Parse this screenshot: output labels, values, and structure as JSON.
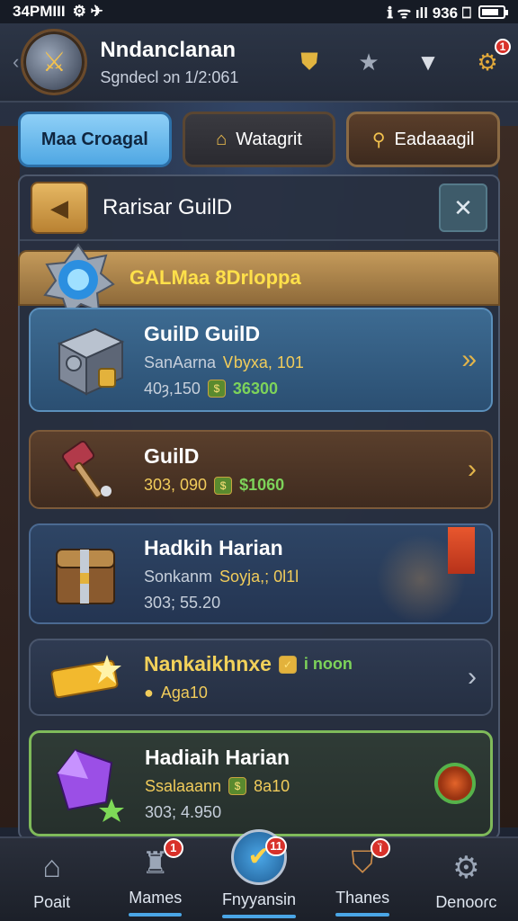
{
  "status": {
    "time": "34PMΙΙΙ",
    "left_icons": "⚙ ✈",
    "right": "ℹ ᯤ ıll 936 ⎕"
  },
  "header": {
    "title": "Nndanclanan",
    "subtitle": "Sgndecl ɔn 1/2:061"
  },
  "tabs": [
    {
      "label": "Maa Croagal"
    },
    {
      "label": "Watagrit"
    },
    {
      "label": "Eadaaagil"
    }
  ],
  "panel": {
    "title": "Rarisar GuilD",
    "section_title": "GALMaa 8Drloppa"
  },
  "items": [
    {
      "name": "GuilD GuilD",
      "line1": "SanAarna",
      "line1b": "Ꮩbyxa, 101",
      "line2": "40ȝ,150",
      "price": "36300"
    },
    {
      "name": "GuilD",
      "line2": "303, 090",
      "price": "$1060"
    },
    {
      "name": "Hadkih Harian",
      "line1": "Sonkanm",
      "line1b": "Soyja,; 0l1l",
      "line2": "303; 55.20"
    },
    {
      "name": "Nankaikhnxe",
      "price": "i noon",
      "line2": "Aga10"
    },
    {
      "name": "Hadiaih Harian",
      "line1": "Ssalaaann",
      "price": "8a10",
      "line2": "303; 4.950"
    }
  ],
  "nav": [
    {
      "label": "Poait",
      "badge": ""
    },
    {
      "label": "Mames",
      "badge": "1"
    },
    {
      "label": "Fnyyansin",
      "badge": "11"
    },
    {
      "label": "Thanes",
      "badge": "ȉ"
    },
    {
      "label": "Denooɾc",
      "badge": ""
    }
  ],
  "header_badge": "1",
  "colors": {
    "accent_blue": "#4fa7e3",
    "gold": "#f2c14e",
    "price_green": "#7dd35a",
    "badge_red": "#d8312a"
  }
}
